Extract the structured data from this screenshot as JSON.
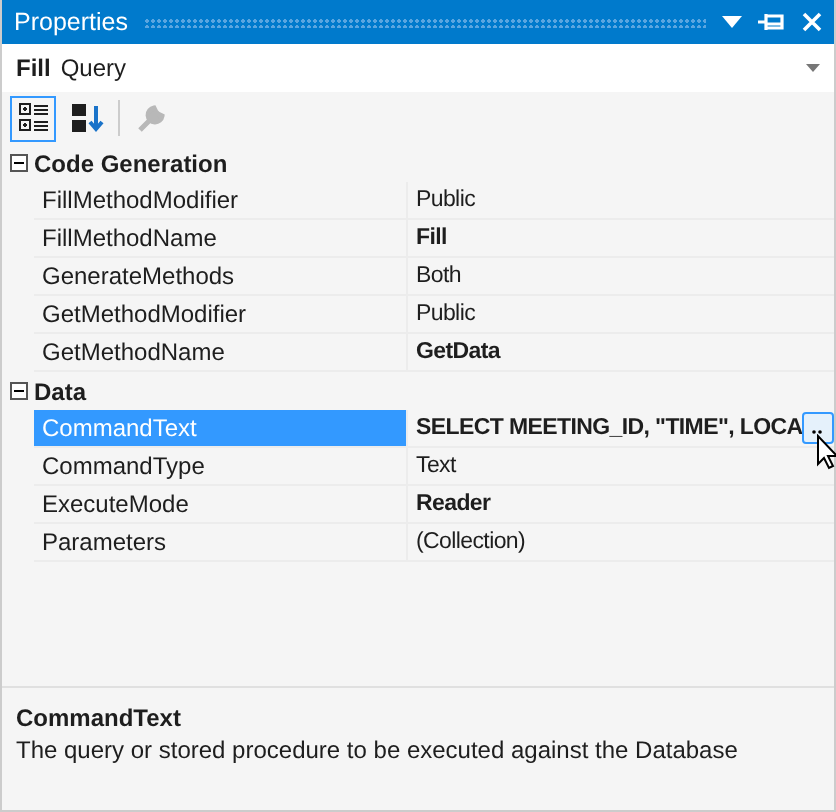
{
  "window": {
    "title": "Properties"
  },
  "object_selector": {
    "name": "Fill",
    "type": "Query"
  },
  "toolbar": [
    {
      "kind": "categorized",
      "selected": true,
      "disabled": false
    },
    {
      "kind": "alphabetical",
      "selected": false,
      "disabled": false
    },
    {
      "kind": "property-pages",
      "selected": false,
      "disabled": true
    }
  ],
  "categories": [
    {
      "name": "Code Generation",
      "expanded": true,
      "properties": [
        {
          "name": "FillMethodModifier",
          "value": "Public",
          "modified": false,
          "selected": false
        },
        {
          "name": "FillMethodName",
          "value": "Fill",
          "modified": true,
          "selected": false
        },
        {
          "name": "GenerateMethods",
          "value": "Both",
          "modified": false,
          "selected": false
        },
        {
          "name": "GetMethodModifier",
          "value": "Public",
          "modified": false,
          "selected": false
        },
        {
          "name": "GetMethodName",
          "value": "GetData",
          "modified": true,
          "selected": false
        }
      ]
    },
    {
      "name": "Data",
      "expanded": true,
      "properties": [
        {
          "name": "CommandText",
          "value": "SELECT MEETING_ID, \"TIME\", LOCA",
          "modified": true,
          "selected": true
        },
        {
          "name": "CommandType",
          "value": "Text",
          "modified": false,
          "selected": false
        },
        {
          "name": "ExecuteMode",
          "value": "Reader",
          "modified": true,
          "selected": false
        },
        {
          "name": "Parameters",
          "value": "(Collection)",
          "modified": false,
          "selected": false
        }
      ]
    }
  ],
  "description": {
    "title": "CommandText",
    "text": "The query or stored procedure to be executed against the Database"
  }
}
